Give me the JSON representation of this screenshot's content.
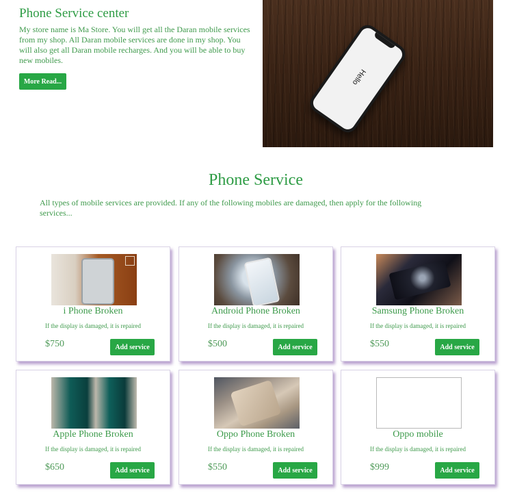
{
  "hero": {
    "title": "Phone Service center",
    "text": "My store name is Ma Store. You will get all the Daran mobile services from my shop. All Daran mobile services are done in my shop. You will also get all Daran mobile recharges. And you will be able to buy new mobiles.",
    "button_label": "More Read...",
    "photo_screen_text": "Hello"
  },
  "services": {
    "title": "Phone Service",
    "text": "All types of mobile services are provided. If any of the following mobiles are damaged, then apply for the following services...",
    "cards": [
      {
        "title": "i Phone Broken",
        "description": "If the display is damaged, it is repaired",
        "price": "$750",
        "button_label": "Add service"
      },
      {
        "title": "Android Phone Broken",
        "description": "If the display is damaged, it is repaired",
        "price": "$500",
        "button_label": "Add service"
      },
      {
        "title": "Samsung Phone Broken",
        "description": "If the display is damaged, it is repaired",
        "price": "$550",
        "button_label": "Add service"
      },
      {
        "title": "Apple Phone Broken",
        "description": "If the display is damaged, it is repaired",
        "price": "$650",
        "button_label": "Add service"
      },
      {
        "title": "Oppo Phone Broken",
        "description": "If the display is damaged, it is repaired",
        "price": "$550",
        "button_label": "Add service"
      },
      {
        "title": "Oppo mobile",
        "description": "If the display is damaged, it is repaired",
        "price": "$999",
        "button_label": "Add service"
      }
    ]
  },
  "colors": {
    "accent_green": "#28a745",
    "text_green": "#3c9a4a",
    "card_shadow": "#8054a8"
  }
}
